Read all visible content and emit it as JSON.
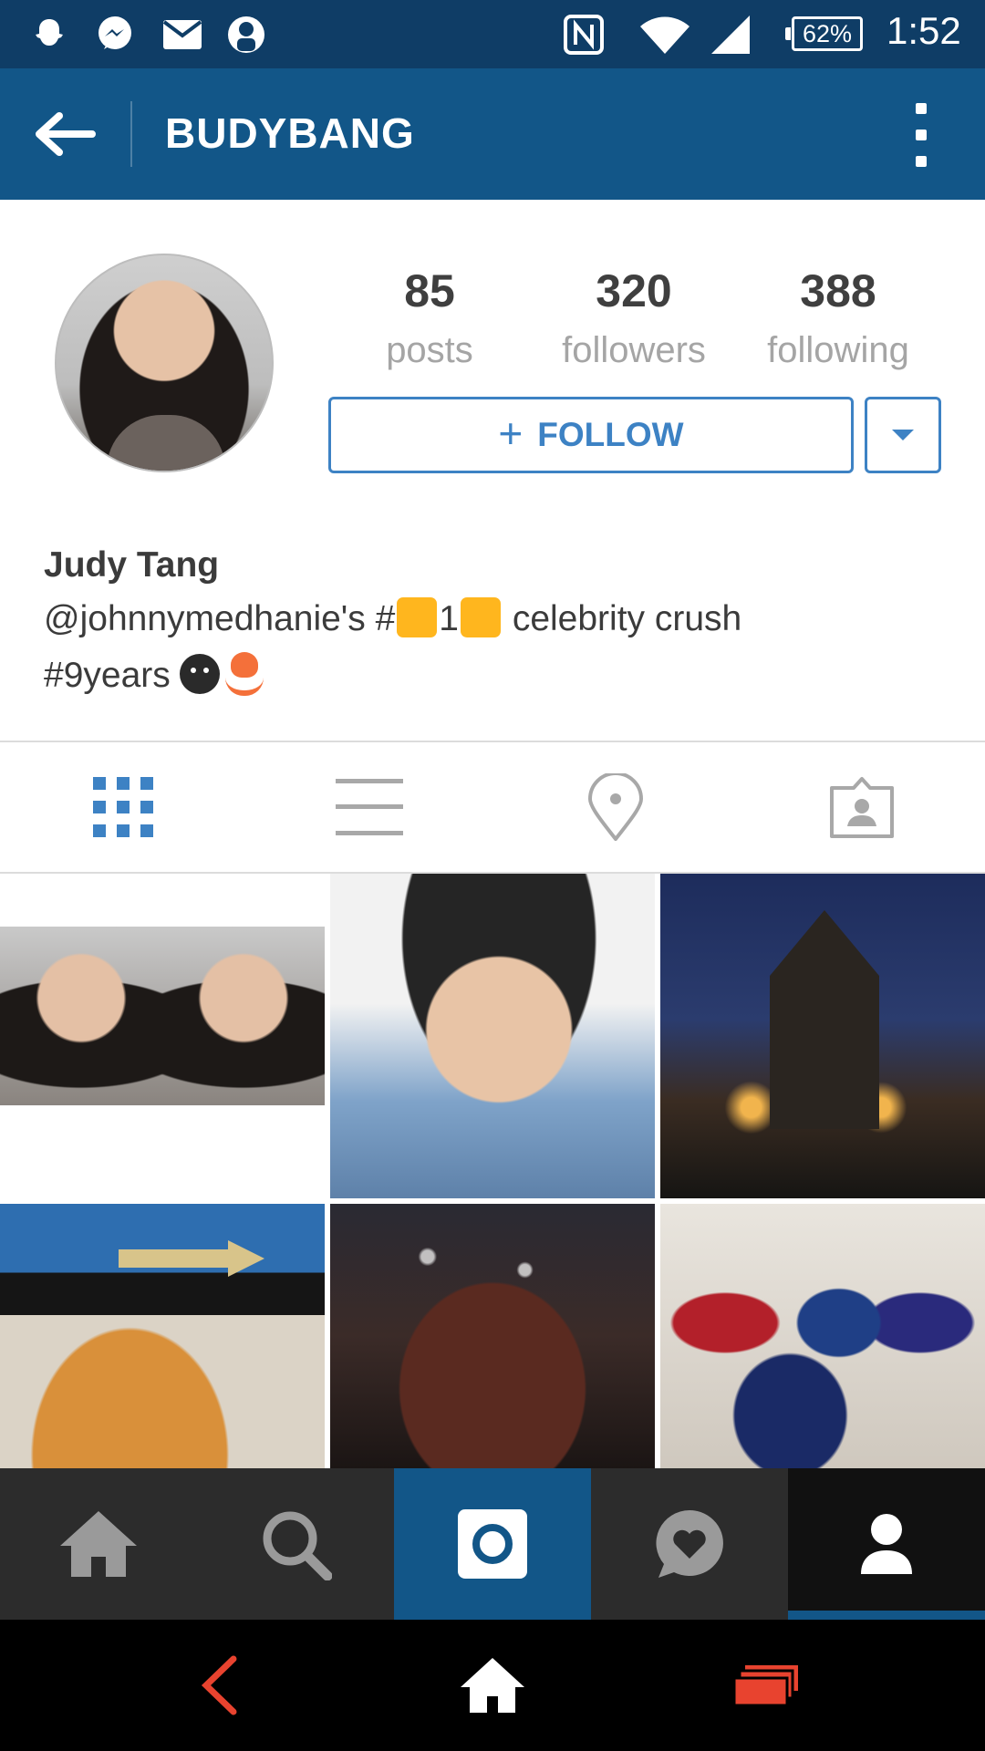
{
  "status_bar": {
    "notification_icons": [
      "snapchat-icon",
      "messenger-icon",
      "mail-icon",
      "astronaut-icon"
    ],
    "system_icons": [
      "nfc-icon",
      "wifi-icon",
      "signal-icon"
    ],
    "battery": "62%",
    "time": "1:52"
  },
  "app_bar": {
    "title": "BUDYBANG",
    "back_icon": "arrow-left-icon",
    "menu_icon": "more-vert-icon"
  },
  "profile": {
    "stats": [
      {
        "value": "85",
        "label": "posts"
      },
      {
        "value": "320",
        "label": "followers"
      },
      {
        "value": "388",
        "label": "following"
      }
    ],
    "follow_plus": "+",
    "follow_label": "FOLLOW",
    "bio": {
      "name": "Judy Tang",
      "line1_a": "@johnnymedhanie's #",
      "line1_b": "1",
      "line1_c": " celebrity crush",
      "line2": "#9years"
    }
  },
  "tabs": [
    {
      "name": "grid-view-icon",
      "active": true
    },
    {
      "name": "list-view-icon",
      "active": false
    },
    {
      "name": "location-pin-icon",
      "active": false
    },
    {
      "name": "tagged-photos-icon",
      "active": false
    }
  ],
  "bottom_nav": [
    {
      "name": "home-icon"
    },
    {
      "name": "search-icon"
    },
    {
      "name": "camera-icon"
    },
    {
      "name": "activity-heart-icon"
    },
    {
      "name": "profile-icon",
      "active": true
    }
  ],
  "system_nav": [
    "back-icon",
    "home-icon",
    "recent-apps-icon"
  ],
  "colors": {
    "brand_blue": "#125688",
    "status_bar": "#0f3d66",
    "accent": "#3d82c4",
    "system_nav_accent": "#e8432f"
  }
}
